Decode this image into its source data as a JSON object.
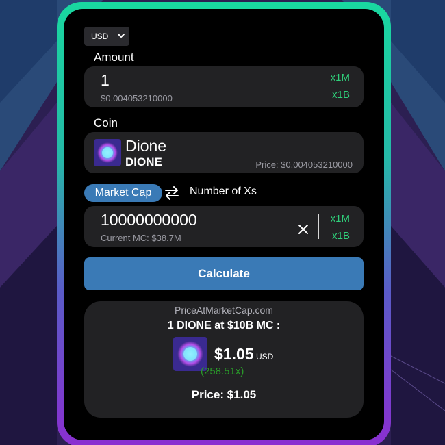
{
  "currency": {
    "selected": "USD"
  },
  "amount": {
    "label": "Amount",
    "value": "1",
    "usd_value": "$0.004053210000",
    "mult_1": "x1M",
    "mult_2": "x1B"
  },
  "coin": {
    "label": "Coin",
    "name": "Dione",
    "ticker": "DIONE",
    "price": "Price: $0.004053210000"
  },
  "mode": {
    "active": "Market Cap",
    "inactive": "Number of Xs"
  },
  "market_cap": {
    "value": "10000000000",
    "current_mc": "Current MC: $38.7M",
    "mult_1": "x1M",
    "mult_2": "x1B"
  },
  "calculate_label": "Calculate",
  "result": {
    "site": "PriceAtMarketCap.com",
    "headline": "1 DIONE at $10B MC :",
    "price": "$1.05",
    "currency": "USD",
    "multiplier": "(258.51x)",
    "footer": "Price: $1.05"
  },
  "colors": {
    "accent_blue": "#3a7ab6",
    "multiplier_green": "#2fd07a",
    "result_green": "#2a9a2a"
  },
  "icons": {
    "coin": "dione-coin-icon",
    "swap": "swap-arrows-icon",
    "clear": "close-icon",
    "dropdown": "chevron-down-icon"
  }
}
